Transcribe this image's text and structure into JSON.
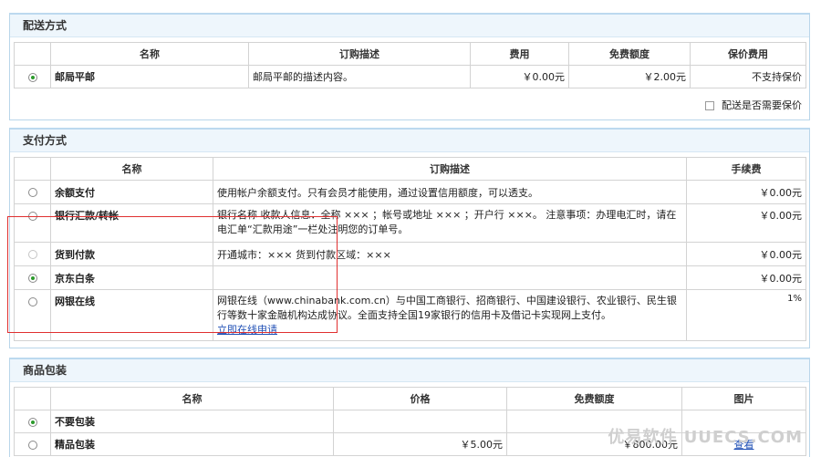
{
  "shipping": {
    "title": "配送方式",
    "headers": [
      "名称",
      "订购描述",
      "费用",
      "免费额度",
      "保价费用"
    ],
    "rows": [
      {
        "name": "邮局平邮",
        "desc": "邮局平邮的描述内容。",
        "fee": "￥0.00元",
        "free": "￥2.00元",
        "insure": "不支持保价"
      }
    ],
    "insure_label": "配送是否需要保价"
  },
  "payment": {
    "title": "支付方式",
    "headers": [
      "名称",
      "订购描述",
      "手续费"
    ],
    "rows": [
      {
        "name": "余额支付",
        "desc": "使用帐户余额支付。只有会员才能使用，通过设置信用额度，可以透支。",
        "fee": "￥0.00元"
      },
      {
        "name": "银行汇款/转帐",
        "desc": "银行名称 收款人信息：全称 ××× ；帐号或地址 ××× ；开户行 ×××。 注意事项：办理电汇时，请在电汇单“汇款用途”一栏处注明您的订单号。",
        "fee": "￥0.00元"
      },
      {
        "name": "货到付款",
        "desc": "开通城市：××× 货到付款区域：×××",
        "fee": "￥0.00元"
      },
      {
        "name": "京东白条",
        "desc": "",
        "fee": "￥0.00元"
      },
      {
        "name": "网银在线",
        "desc": "网银在线（www.chinabank.com.cn）与中国工商银行、招商银行、中国建设银行、农业银行、民生银行等数十家金融机构达成协议。全面支持全国19家银行的信用卡及借记卡实现网上支付。",
        "link": "立即在线申请",
        "fee": "1%"
      }
    ]
  },
  "packaging": {
    "title": "商品包装",
    "headers": [
      "名称",
      "价格",
      "免费额度",
      "图片"
    ],
    "rows": [
      {
        "name": "不要包装",
        "price": "",
        "free": "",
        "img": ""
      },
      {
        "name": "精品包装",
        "price": "￥5.00元",
        "free": "￥800.00元",
        "img": "查看"
      }
    ]
  },
  "watermark": "优易软件 UUECS.COM"
}
